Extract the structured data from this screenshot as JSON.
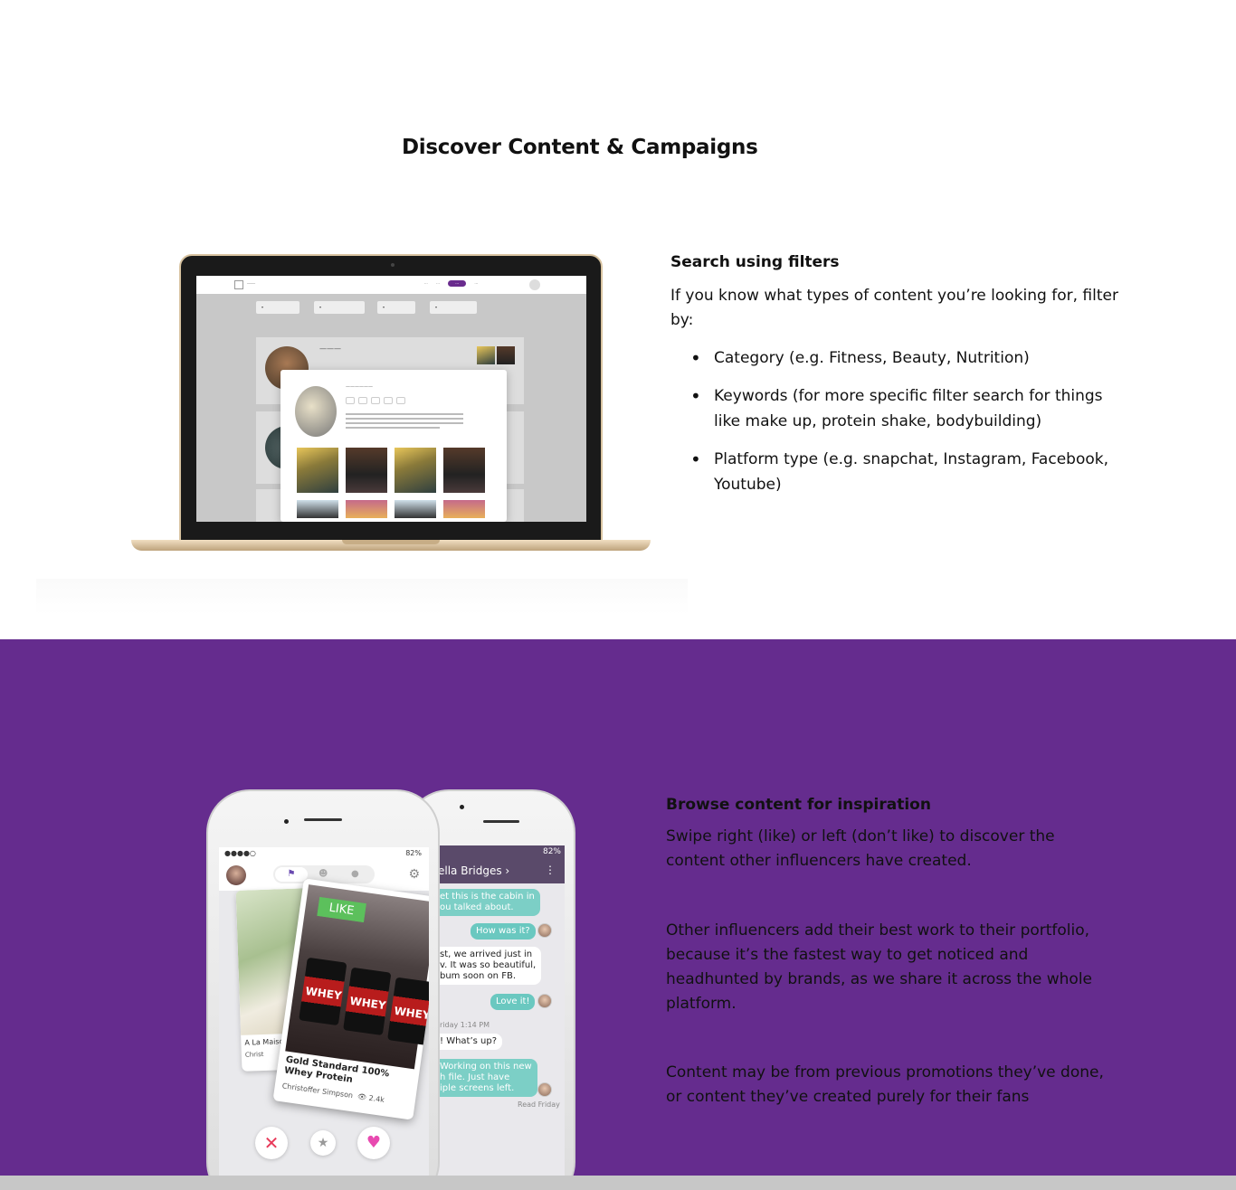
{
  "page": {
    "title": "Discover Content & Campaigns",
    "colors": {
      "purple_section": "#652c8e",
      "accent": "#6a2c8e"
    }
  },
  "search_section": {
    "heading": "Search using filters",
    "intro": "If you know what types of content you’re looking for, filter by:",
    "bullets": [
      "Category (e.g. Fitness, Beauty, Nutrition)",
      "Keywords (for more specific filter search for things like make up, protein shake, bodybuilding)",
      "Platform type (e.g. snapchat, Instagram, Facebook, Youtube)"
    ]
  },
  "browse_section": {
    "heading": "Browse content for inspiration",
    "paragraphs": [
      "Swipe right (like) or left (don’t like) to discover the content other influencers have created.",
      "Other influencers add their best work to their portfolio, because it’s the fastest way to get noticed and headhunted by brands, as we share it across the whole platform.",
      "Content may be from previous promotions they’ve done, or content they’ve created purely for their fans"
    ]
  },
  "chat_phone": {
    "battery": "82%",
    "contact": "ella Bridges",
    "messages": [
      {
        "text": "et this is the cabin in",
        "text2": "ou talked about."
      },
      {
        "text": "How was it?"
      },
      {
        "text": "st, we arrived just in",
        "text2": "v. It was so beautiful,",
        "text3": "bum soon on FB."
      },
      {
        "text": "Love it!"
      },
      {
        "text": "Friday 1:14 PM"
      },
      {
        "text": "! What’s up?"
      },
      {
        "text": "Working on this new",
        "text2": "h file. Just have",
        "text3": "iple screens left."
      },
      {
        "text": "Read Friday"
      }
    ]
  },
  "swipe_phone": {
    "battery": "82%",
    "like_badge": "LIKE",
    "front_card_title": "Gold Standard 100% Whey Protein",
    "front_card_author": "Christoffer Simpson",
    "front_card_views": "2.4k",
    "tub_label": "WHEY",
    "back_card_title": "A La Maison Hand & Bo",
    "back_card_author": "Christ"
  }
}
